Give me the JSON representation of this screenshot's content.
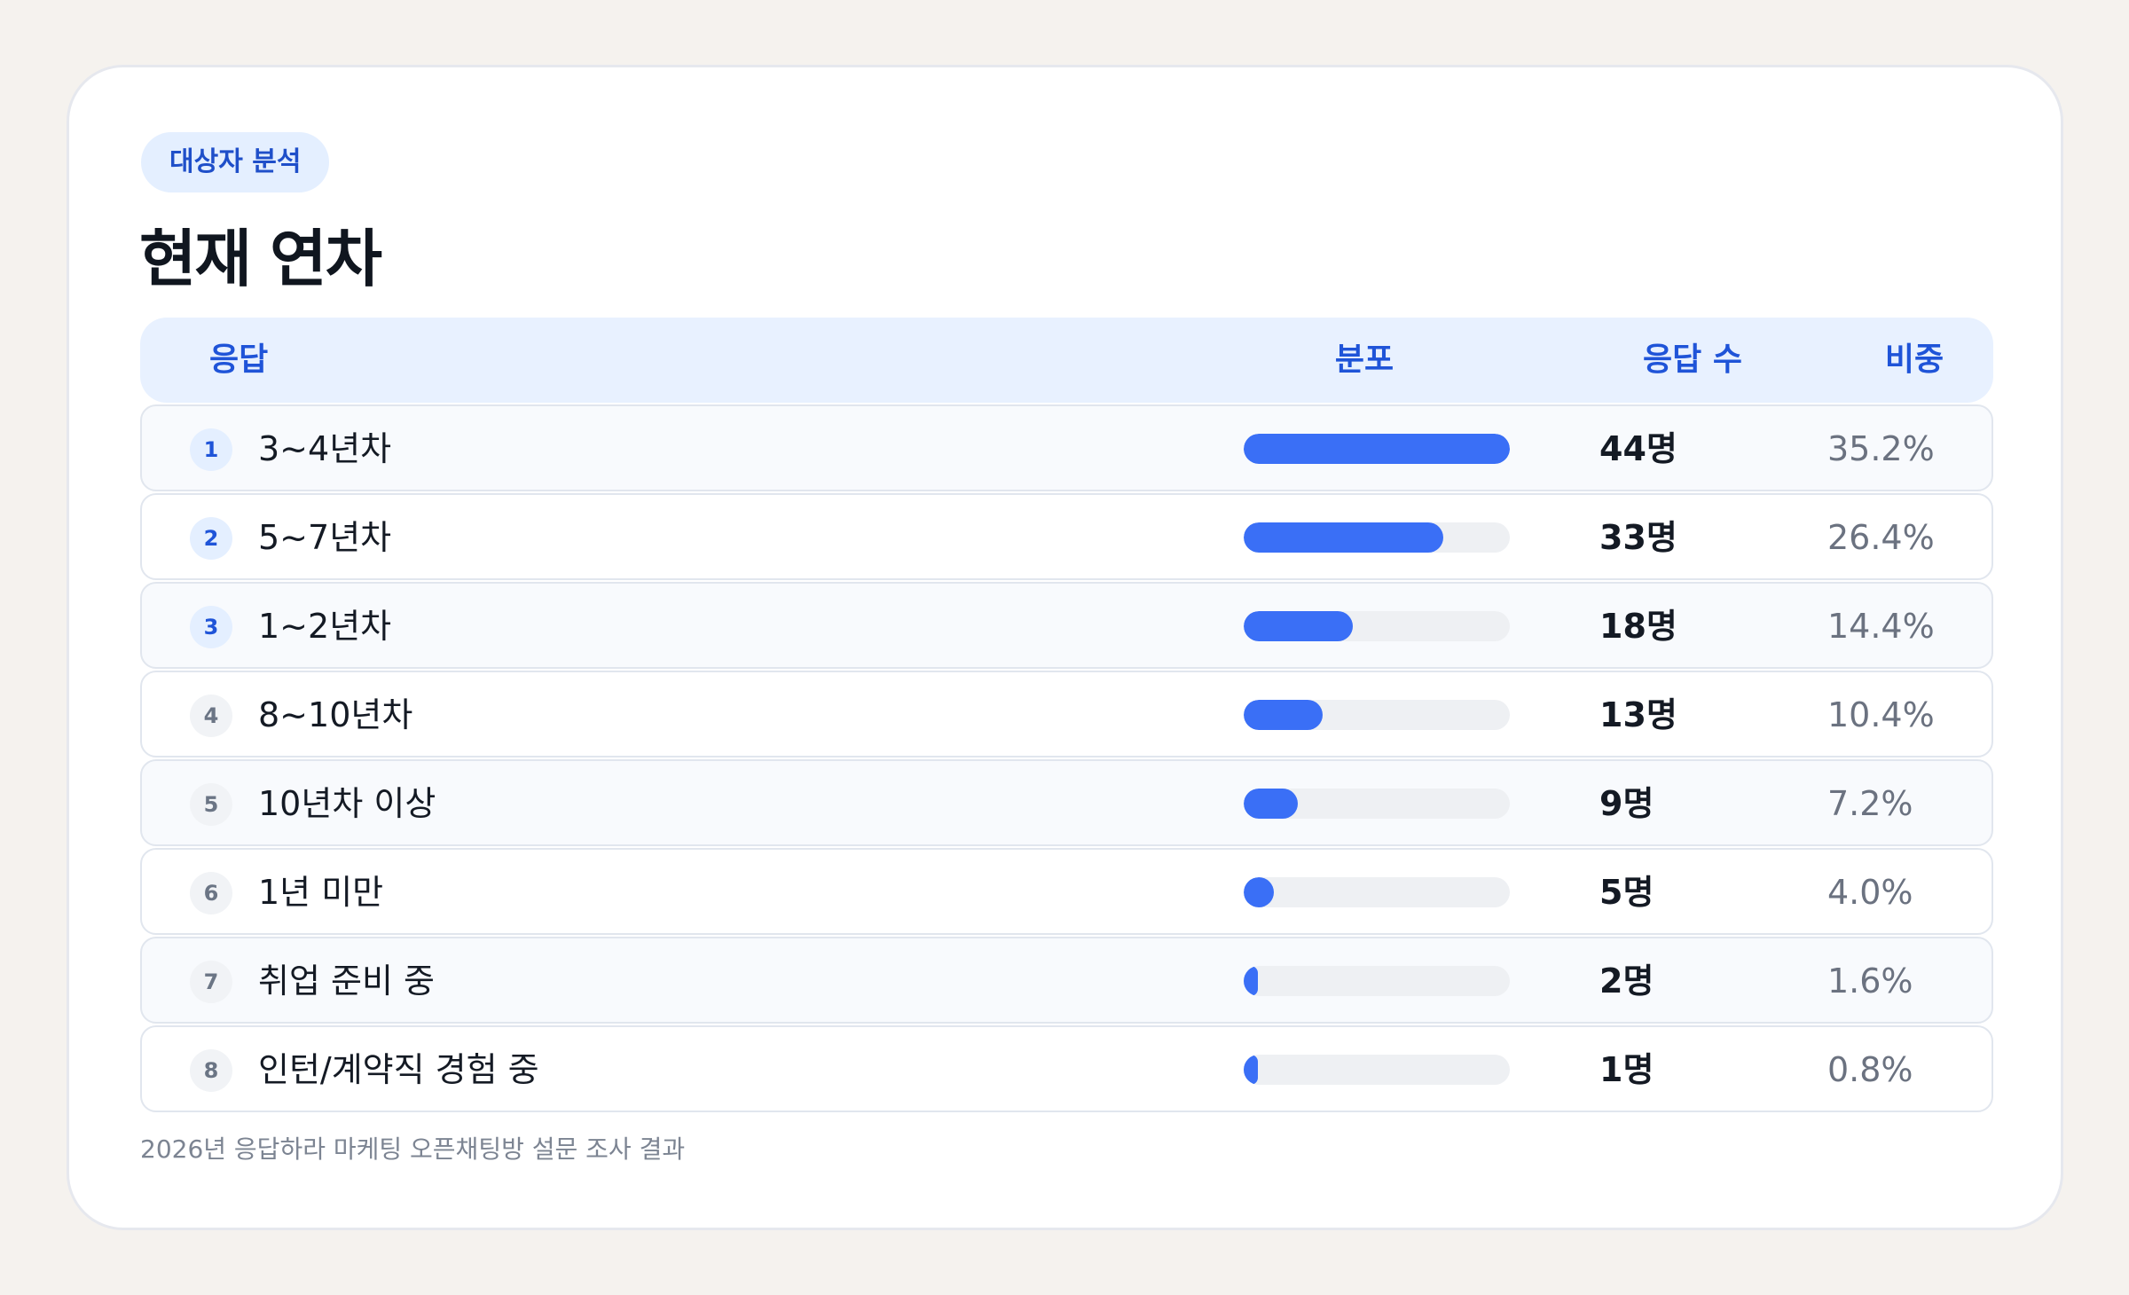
{
  "badge": "대상자 분석",
  "title": "현재 연차",
  "headers": {
    "response": "응답",
    "distribution": "분포",
    "count": "응답 수",
    "share": "비중"
  },
  "footnote": "2026년 응답하라 마케팅 오픈채팅방 설문 조사 결과",
  "colors": {
    "accent": "#3a6ff6",
    "track": "#eef0f3",
    "header_bg": "#e8f1ff",
    "header_text": "#1f54d8"
  },
  "chart_data": {
    "type": "bar",
    "orientation": "horizontal",
    "title": "현재 연차",
    "categories": [
      "3~4년차",
      "5~7년차",
      "1~2년차",
      "8~10년차",
      "10년차 이상",
      "1년 미만",
      "취업 준비 중",
      "인턴/계약직 경험 중"
    ],
    "values": [
      44,
      33,
      18,
      13,
      9,
      5,
      2,
      1
    ],
    "xlim": [
      0,
      44
    ],
    "rows": [
      {
        "rank": "1",
        "label": "3~4년차",
        "count": "44명",
        "share": "35.2%",
        "value": 44
      },
      {
        "rank": "2",
        "label": "5~7년차",
        "count": "33명",
        "share": "26.4%",
        "value": 33
      },
      {
        "rank": "3",
        "label": "1~2년차",
        "count": "18명",
        "share": "14.4%",
        "value": 18
      },
      {
        "rank": "4",
        "label": "8~10년차",
        "count": "13명",
        "share": "10.4%",
        "value": 13
      },
      {
        "rank": "5",
        "label": "10년차 이상",
        "count": "9명",
        "share": "7.2%",
        "value": 9
      },
      {
        "rank": "6",
        "label": "1년 미만",
        "count": "5명",
        "share": "4.0%",
        "value": 5
      },
      {
        "rank": "7",
        "label": "취업 준비 중",
        "count": "2명",
        "share": "1.6%",
        "value": 2
      },
      {
        "rank": "8",
        "label": "인턴/계약직 경험 중",
        "count": "1명",
        "share": "0.8%",
        "value": 1
      }
    ]
  }
}
